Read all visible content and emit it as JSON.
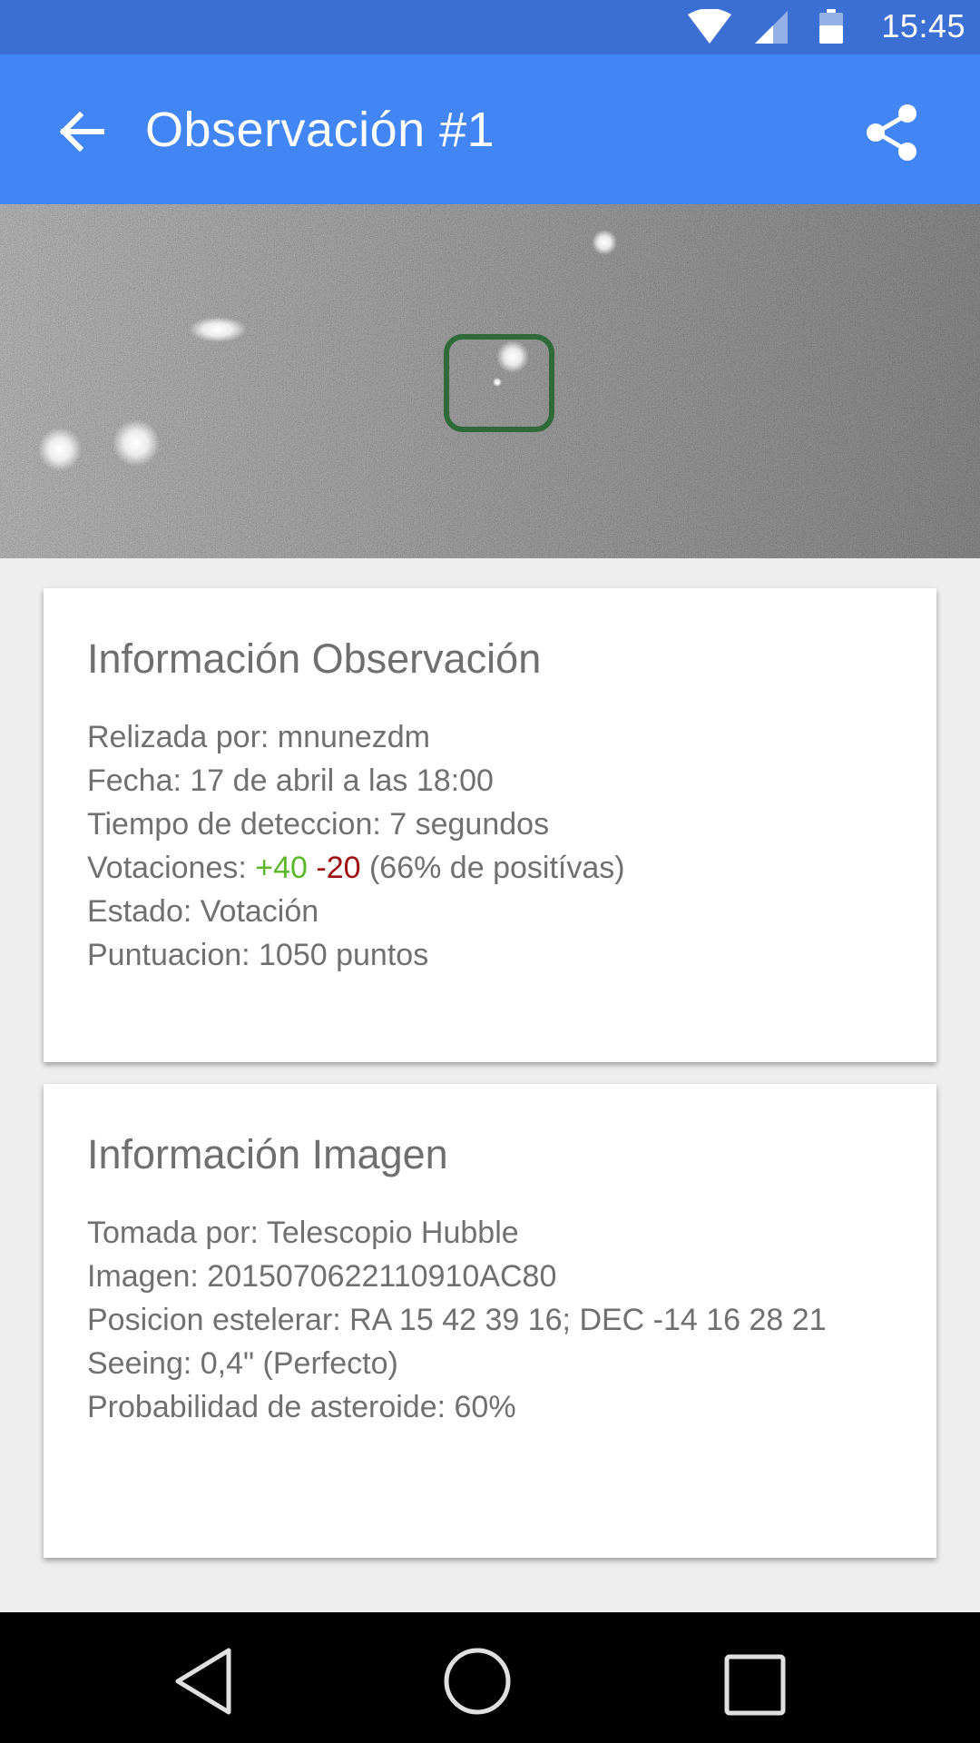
{
  "status_bar": {
    "time": "15:45"
  },
  "app_bar": {
    "title": "Observación #1"
  },
  "icons": [
    "wifi-icon",
    "signal-icon",
    "battery-icon",
    "back-arrow-icon",
    "share-icon",
    "nav-back-icon",
    "nav-home-icon",
    "nav-recents-icon"
  ],
  "colors": {
    "status_bar": "#3c6fd3",
    "app_bar": "#4285f4",
    "positive_votes": "#5cb82a",
    "negative_votes": "#a01010",
    "detection_box": "#2f6a3a"
  },
  "observation_card": {
    "title": "Información Observación",
    "performed_by": "Relizada por: mnunezdm",
    "date": "Fecha: 17 de abril a las 18:00",
    "detection_time": "Tiempo de deteccion: 7 segundos",
    "votes_label": "Votaciones:",
    "votes_positive": "+40",
    "votes_negative": "-20",
    "votes_ratio": "(66% de positívas)",
    "state": "Estado: Votación",
    "score": "Puntuacion: 1050 puntos"
  },
  "image_card": {
    "title": "Información Imagen",
    "taken_by": "Tomada por: Telescopio Hubble",
    "image_id": "Imagen: 2015070622110910AC80",
    "position": "Posicion estelerar: RA 15 42 39 16; DEC -14 16 28 21",
    "seeing": "Seeing: 0,4\" (Perfecto)",
    "asteroid_probability": "Probabilidad de asteroide: 60%"
  }
}
